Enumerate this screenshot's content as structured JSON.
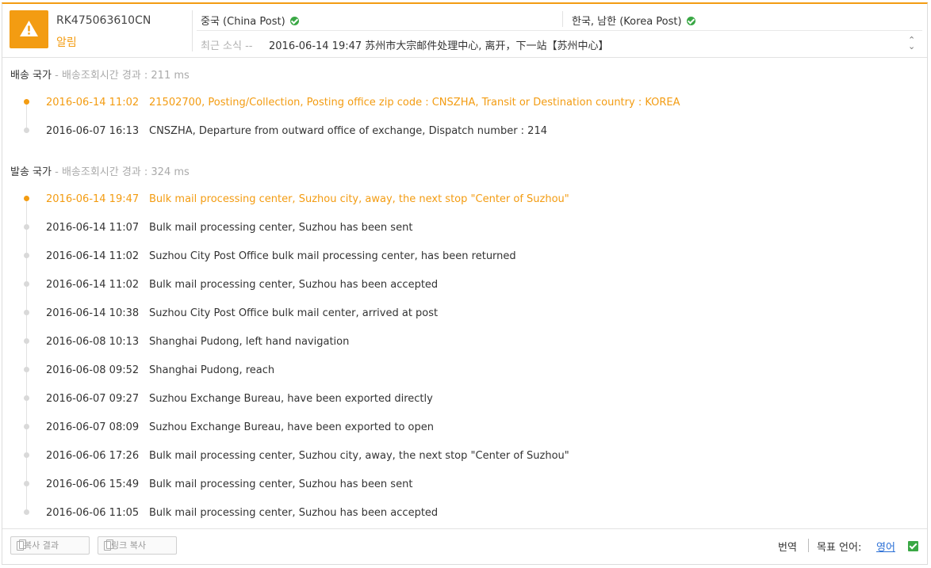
{
  "header": {
    "tracking_number": "RK475063610CN",
    "status": "알림",
    "origin_carrier": "중국 (China Post)",
    "destination_carrier": "한국, 남한 (Korea Post)",
    "latest_label": "최근 소식 --",
    "latest_text": "2016-06-14 19:47 苏州市大宗邮件处理中心, 离开，下一站【苏州中心】",
    "icons": {
      "alert": "warning-icon",
      "carrier_status": "check-circle-icon",
      "expand": "expand-collapse-icon"
    }
  },
  "destination_section": {
    "title": "배송 국가",
    "subtitle": " - 배송조회시간 경과 : 211 ms",
    "events": [
      {
        "time": "2016-06-14 11:02",
        "desc": "21502700, Posting/Collection, Posting office zip code : CNSZHA, Transit or Destination country : KOREA",
        "active": true
      },
      {
        "time": "2016-06-07 16:13",
        "desc": "CNSZHA, Departure from outward office of exchange, Dispatch number : 214",
        "active": false
      }
    ]
  },
  "origin_section": {
    "title": "발송 국가",
    "subtitle": " - 배송조회시간 경과 : 324 ms",
    "events": [
      {
        "time": "2016-06-14 19:47",
        "desc": "Bulk mail processing center, Suzhou city, away, the next stop \"Center of Suzhou\"",
        "active": true
      },
      {
        "time": "2016-06-14 11:07",
        "desc": "Bulk mail processing center, Suzhou has been sent",
        "active": false
      },
      {
        "time": "2016-06-14 11:02",
        "desc": "Suzhou City Post Office bulk mail processing center, has been returned",
        "active": false
      },
      {
        "time": "2016-06-14 11:02",
        "desc": "Bulk mail processing center, Suzhou has been accepted",
        "active": false
      },
      {
        "time": "2016-06-14 10:38",
        "desc": "Suzhou City Post Office bulk mail center, arrived at post",
        "active": false
      },
      {
        "time": "2016-06-08 10:13",
        "desc": "Shanghai Pudong, left hand navigation",
        "active": false
      },
      {
        "time": "2016-06-08 09:52",
        "desc": "Shanghai Pudong, reach",
        "active": false
      },
      {
        "time": "2016-06-07 09:27",
        "desc": "Suzhou Exchange Bureau, have been exported directly",
        "active": false
      },
      {
        "time": "2016-06-07 08:09",
        "desc": "Suzhou Exchange Bureau, have been exported to open",
        "active": false
      },
      {
        "time": "2016-06-06 17:26",
        "desc": "Bulk mail processing center, Suzhou city, away, the next stop \"Center of Suzhou\"",
        "active": false
      },
      {
        "time": "2016-06-06 15:49",
        "desc": "Bulk mail processing center, Suzhou has been sent",
        "active": false
      },
      {
        "time": "2016-06-06 11:05",
        "desc": "Bulk mail processing center, Suzhou has been accepted",
        "active": false
      }
    ]
  },
  "footer": {
    "copy_result_label": "복사 결과",
    "copy_link_label": "링크 복사",
    "translate_label": "번역",
    "target_language_label": "목표 언어:",
    "target_language": "영어",
    "translate_enabled": true
  },
  "colors": {
    "accent": "#f39c12",
    "success": "#3aa845",
    "link": "#2a6fd6"
  }
}
